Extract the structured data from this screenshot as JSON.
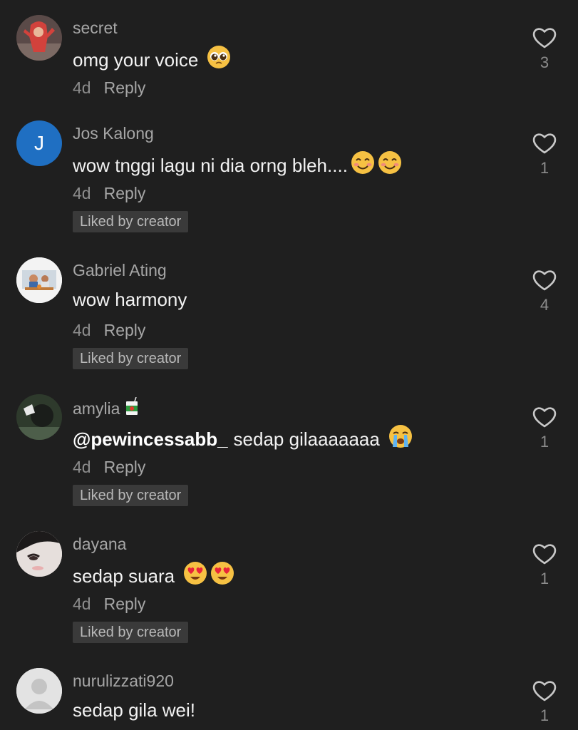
{
  "comments": [
    {
      "username": "secret",
      "text": "omg your voice",
      "time": "4d",
      "reply": "Reply",
      "likes": "3",
      "avatar": {
        "type": "photo",
        "icon": "avatar-photo-person-pink",
        "color": "#c9453f"
      },
      "emojis": [
        "pleading-face-emoji"
      ]
    },
    {
      "username": "Jos Kalong",
      "text": "wow tnggi lagu ni dia orng bleh....",
      "time": "4d",
      "reply": "Reply",
      "likes": "1",
      "avatar": {
        "type": "letter",
        "letter": "J",
        "color": "#1f6fc2"
      },
      "emojis": [
        "smiling-face-emoji",
        "smiling-face-emoji"
      ],
      "badge": "Liked by creator"
    },
    {
      "username": "Gabriel Ating",
      "text": "wow harmony",
      "time": "4d",
      "reply": "Reply",
      "likes": "4",
      "avatar": {
        "type": "photo",
        "icon": "avatar-photo-people-table",
        "color": "#ffffff"
      },
      "badge": "Liked by creator"
    },
    {
      "username": "amylia",
      "mention": "@pewincessabb_",
      "text": "sedap gilaaaaaaa",
      "time": "4d",
      "reply": "Reply",
      "likes": "1",
      "avatar": {
        "type": "photo",
        "icon": "avatar-photo-dark-portrait",
        "color": "#3b4a3a"
      },
      "username_emoji": "juice-box-emoji",
      "emojis": [
        "loudly-crying-face-emoji"
      ],
      "badge": "Liked by creator"
    },
    {
      "username": "dayana",
      "text": "sedap suara",
      "time": "4d",
      "reply": "Reply",
      "likes": "1",
      "avatar": {
        "type": "photo",
        "icon": "avatar-photo-face-closeup",
        "color": "#d9d4d2"
      },
      "emojis": [
        "heart-eyes-emoji",
        "heart-eyes-emoji"
      ],
      "badge": "Liked by creator"
    },
    {
      "username": "nurulizzati920",
      "text": "sedap gila wei!",
      "time": "",
      "reply": "",
      "likes": "1",
      "avatar": {
        "type": "default",
        "icon": "default-avatar-icon",
        "color": "#e0e0e0"
      }
    }
  ],
  "colors": {
    "background": "#1f1f1f",
    "primary_text": "#f2f2f2",
    "secondary_text": "#a6a6a6",
    "badge_bg": "#3a3a3a"
  }
}
